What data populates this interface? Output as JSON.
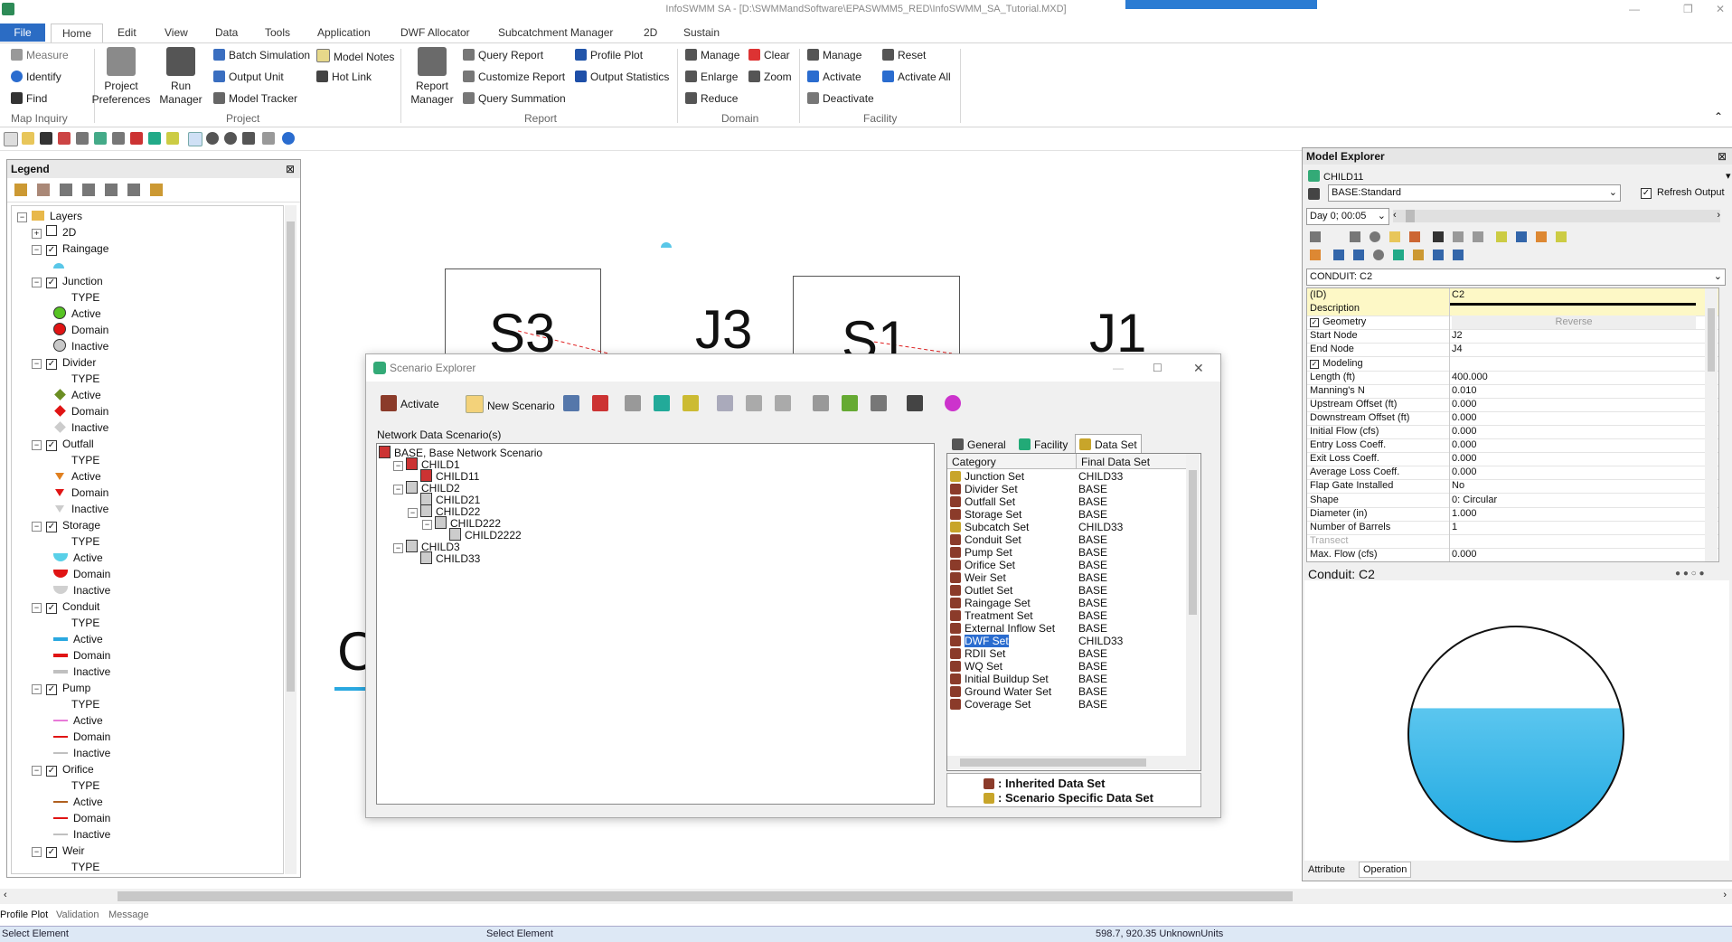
{
  "window": {
    "title": "InfoSWMM SA - [D:\\SWMMandSoftware\\EPASWMM5_RED\\InfoSWMM_SA_Tutorial.MXD]"
  },
  "ribbon": {
    "tabs": [
      "File",
      "Home",
      "Edit",
      "View",
      "Data",
      "Tools",
      "Application",
      "DWF Allocator",
      "Subcatchment Manager",
      "2D",
      "Sustain"
    ],
    "map_inquiry": {
      "measure": "Measure",
      "identify": "Identify",
      "find": "Find",
      "group": "Map Inquiry"
    },
    "project": {
      "project_pref": "Project Preferences",
      "run_manager": "Run Manager",
      "batch": "Batch Simulation",
      "output_unit": "Output Unit",
      "model_tracker": "Model Tracker",
      "model_notes": "Model Notes",
      "hot_link": "Hot Link",
      "group": "Project"
    },
    "report": {
      "report_manager": "Report Manager",
      "query_report": "Query Report",
      "customize_report": "Customize Report",
      "query_summation": "Query Summation",
      "profile_plot": "Profile Plot",
      "output_statistics": "Output Statistics",
      "group": "Report"
    },
    "domain": {
      "manage": "Manage",
      "clear": "Clear",
      "enlarge": "Enlarge",
      "zoom": "Zoom",
      "reduce": "Reduce",
      "group": "Domain"
    },
    "facility": {
      "manage": "Manage",
      "reset": "Reset",
      "activate": "Activate",
      "activate_all": "Activate All",
      "deactivate": "Deactivate",
      "group": "Facility"
    }
  },
  "legend": {
    "title": "Legend",
    "rows": [
      {
        "label": "Layers",
        "kind": "root"
      },
      {
        "label": "2D",
        "kind": "layer-plus"
      },
      {
        "label": "Raingage",
        "kind": "layer"
      },
      {
        "label": "",
        "kind": "sym",
        "color": "#59c7e8"
      },
      {
        "label": "Junction",
        "kind": "layer"
      },
      {
        "label": "TYPE",
        "kind": "type"
      },
      {
        "label": "Active",
        "kind": "sym",
        "color": "#57c323",
        "shape": "circle"
      },
      {
        "label": "Domain",
        "kind": "sym",
        "color": "#e01414",
        "shape": "circle"
      },
      {
        "label": "Inactive",
        "kind": "sym",
        "color": "#c8c8c8",
        "shape": "circle"
      },
      {
        "label": "Divider",
        "kind": "layer"
      },
      {
        "label": "TYPE",
        "kind": "type"
      },
      {
        "label": "Active",
        "kind": "sym",
        "color": "#6b8e23",
        "shape": "diamond"
      },
      {
        "label": "Domain",
        "kind": "sym",
        "color": "#e01414",
        "shape": "diamond"
      },
      {
        "label": "Inactive",
        "kind": "sym",
        "color": "#cccccc",
        "shape": "diamond"
      },
      {
        "label": "Outfall",
        "kind": "layer"
      },
      {
        "label": "TYPE",
        "kind": "type"
      },
      {
        "label": "Active",
        "kind": "sym",
        "color": "#e08020",
        "shape": "tri"
      },
      {
        "label": "Domain",
        "kind": "sym",
        "color": "#e01414",
        "shape": "tri"
      },
      {
        "label": "Inactive",
        "kind": "sym",
        "color": "#cccccc",
        "shape": "tri"
      },
      {
        "label": "Storage",
        "kind": "layer"
      },
      {
        "label": "TYPE",
        "kind": "type"
      },
      {
        "label": "Active",
        "kind": "sym",
        "color": "#59d0e8",
        "shape": "bowl"
      },
      {
        "label": "Domain",
        "kind": "sym",
        "color": "#e01414",
        "shape": "bowl"
      },
      {
        "label": "Inactive",
        "kind": "sym",
        "color": "#d0d0d0",
        "shape": "bowl"
      },
      {
        "label": "Conduit",
        "kind": "layer"
      },
      {
        "label": "TYPE",
        "kind": "type"
      },
      {
        "label": "Active",
        "kind": "sym",
        "color": "#2aa8e0",
        "shape": "line"
      },
      {
        "label": "Domain",
        "kind": "sym",
        "color": "#e01414",
        "shape": "line"
      },
      {
        "label": "Inactive",
        "kind": "sym",
        "color": "#c0c0c0",
        "shape": "line"
      },
      {
        "label": "Pump",
        "kind": "layer"
      },
      {
        "label": "TYPE",
        "kind": "type"
      },
      {
        "label": "Active",
        "kind": "sym",
        "color": "#e87ad8",
        "shape": "thin"
      },
      {
        "label": "Domain",
        "kind": "sym",
        "color": "#e01414",
        "shape": "thin"
      },
      {
        "label": "Inactive",
        "kind": "sym",
        "color": "#c0c0c0",
        "shape": "thin"
      },
      {
        "label": "Orifice",
        "kind": "layer"
      },
      {
        "label": "TYPE",
        "kind": "type"
      },
      {
        "label": "Active",
        "kind": "sym",
        "color": "#b06020",
        "shape": "thin"
      },
      {
        "label": "Domain",
        "kind": "sym",
        "color": "#e01414",
        "shape": "thin"
      },
      {
        "label": "Inactive",
        "kind": "sym",
        "color": "#c0c0c0",
        "shape": "thin"
      },
      {
        "label": "Weir",
        "kind": "layer"
      },
      {
        "label": "TYPE",
        "kind": "type"
      }
    ]
  },
  "canvas": {
    "labels": [
      "S3",
      "J3",
      "S1",
      "J1",
      "C"
    ]
  },
  "scenario": {
    "title": "Scenario Explorer",
    "toolbar": {
      "activate": "Activate",
      "new_scenario": "New Scenario"
    },
    "tree_label": "Network Data Scenario(s)",
    "tree": [
      {
        "label": "BASE, Base Network Scenario",
        "level": 0,
        "red": true
      },
      {
        "label": "CHILD1",
        "level": 1,
        "red": true,
        "exp": "−"
      },
      {
        "label": "CHILD11",
        "level": 2,
        "red": true
      },
      {
        "label": "CHILD2",
        "level": 1,
        "exp": "−"
      },
      {
        "label": "CHILD21",
        "level": 2
      },
      {
        "label": "CHILD22",
        "level": 2,
        "exp": "−"
      },
      {
        "label": "CHILD222",
        "level": 3,
        "exp": "−"
      },
      {
        "label": "CHILD2222",
        "level": 4
      },
      {
        "label": "CHILD3",
        "level": 1,
        "exp": "−"
      },
      {
        "label": "CHILD33",
        "level": 2
      }
    ],
    "tabs": [
      "General",
      "Facility",
      "Data Set"
    ],
    "table_headers": [
      "Category",
      "Final Data Set"
    ],
    "rows": [
      {
        "cat": "Junction Set",
        "val": "CHILD33",
        "y": true
      },
      {
        "cat": "Divider Set",
        "val": "BASE"
      },
      {
        "cat": "Outfall Set",
        "val": "BASE"
      },
      {
        "cat": "Storage Set",
        "val": "BASE"
      },
      {
        "cat": "Subcatch Set",
        "val": "CHILD33",
        "y": true
      },
      {
        "cat": "Conduit Set",
        "val": "BASE"
      },
      {
        "cat": "Pump Set",
        "val": "BASE"
      },
      {
        "cat": "Orifice Set",
        "val": "BASE"
      },
      {
        "cat": "Weir Set",
        "val": "BASE"
      },
      {
        "cat": "Outlet Set",
        "val": "BASE"
      },
      {
        "cat": "Raingage Set",
        "val": "BASE"
      },
      {
        "cat": "Treatment Set",
        "val": "BASE"
      },
      {
        "cat": "External Inflow Set",
        "val": "BASE"
      },
      {
        "cat": "DWF Set",
        "val": "CHILD33",
        "sel": true
      },
      {
        "cat": "RDII Set",
        "val": "BASE"
      },
      {
        "cat": "WQ Set",
        "val": "BASE"
      },
      {
        "cat": "Initial Buildup Set",
        "val": "BASE"
      },
      {
        "cat": "Ground Water Set",
        "val": "BASE"
      },
      {
        "cat": "Coverage Set",
        "val": "BASE"
      }
    ],
    "legend_inherited": ": Inherited Data Set",
    "legend_specific": ": Scenario Specific Data Set"
  },
  "model": {
    "title": "Model Explorer",
    "scenario": "CHILD11",
    "output": "BASE:Standard",
    "refresh_label": "Refresh Output",
    "time": "Day 0;  00:05",
    "element": "CONDUIT: C2",
    "props": [
      {
        "k": "(ID)",
        "v": "C2",
        "hl": true
      },
      {
        "k": "Description",
        "v": "",
        "hl": true
      },
      {
        "k": "Geometry",
        "v": "Reverse",
        "sec": true
      },
      {
        "k": "Start Node",
        "v": "J2"
      },
      {
        "k": "End Node",
        "v": "J4"
      },
      {
        "k": "Modeling",
        "v": "",
        "sec": true
      },
      {
        "k": "Length (ft)",
        "v": "400.000"
      },
      {
        "k": "Manning's N",
        "v": "0.010"
      },
      {
        "k": "Upstream Offset (ft)",
        "v": "0.000"
      },
      {
        "k": "Downstream Offset (ft)",
        "v": "0.000"
      },
      {
        "k": "Initial Flow (cfs)",
        "v": "0.000"
      },
      {
        "k": "Entry Loss Coeff.",
        "v": "0.000"
      },
      {
        "k": "Exit Loss Coeff.",
        "v": "0.000"
      },
      {
        "k": "Average Loss Coeff.",
        "v": "0.000"
      },
      {
        "k": "Flap Gate Installed",
        "v": "No"
      },
      {
        "k": "Shape",
        "v": "0: Circular"
      },
      {
        "k": "Diameter (in)",
        "v": "1.000"
      },
      {
        "k": "Number of Barrels",
        "v": "1"
      },
      {
        "k": "Transect",
        "v": "",
        "dim": true
      },
      {
        "k": "Max. Flow (cfs)",
        "v": "0.000"
      }
    ],
    "graphic_title": "Conduit: C2",
    "fill_fraction": 0.62,
    "bottom_tabs": [
      "Attribute",
      "Operation"
    ]
  },
  "bottom_tabs": [
    "Profile Plot",
    "Validation",
    "Message"
  ],
  "status": {
    "left": "Select Element",
    "mid": "Select Element",
    "coords": "598.7, 920.35  UnknownUnits"
  }
}
